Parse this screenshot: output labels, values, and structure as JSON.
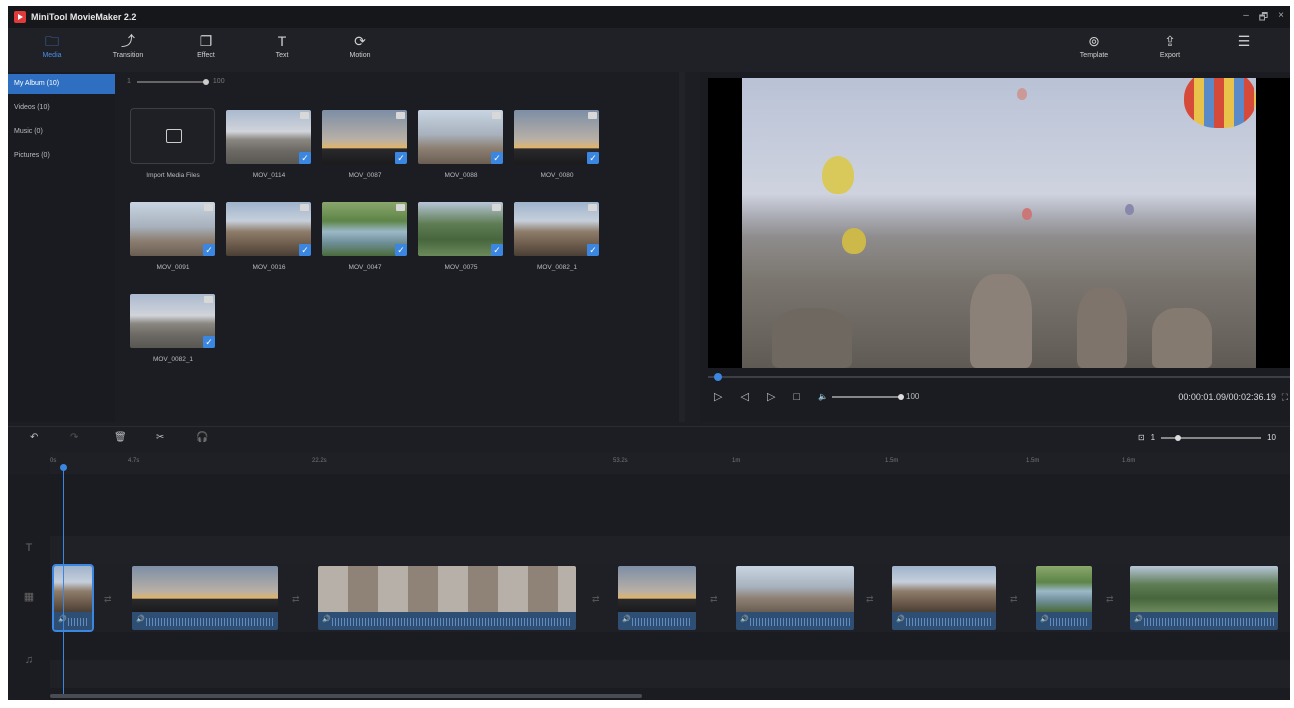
{
  "app": {
    "title": "MiniTool MovieMaker 2.2",
    "window_controls": [
      "–",
      "🗗",
      "×"
    ]
  },
  "toolbar": {
    "tabs": [
      {
        "label": "Media",
        "icon": "folder-icon",
        "glyph": "🗀"
      },
      {
        "label": "Transition",
        "icon": "transition-icon",
        "glyph": "⤴"
      },
      {
        "label": "Effect",
        "icon": "effect-icon",
        "glyph": "❐"
      },
      {
        "label": "Text",
        "icon": "text-icon",
        "glyph": "T"
      },
      {
        "label": "Motion",
        "icon": "motion-icon",
        "glyph": "⟳"
      }
    ],
    "right": [
      {
        "label": "Template",
        "icon": "template-icon",
        "glyph": "⊚"
      },
      {
        "label": "Export",
        "icon": "export-icon",
        "glyph": "⇪"
      },
      {
        "label": "",
        "icon": "menu-icon",
        "glyph": "☰"
      }
    ]
  },
  "library": {
    "categories": [
      "My Album (10)",
      "Videos (10)",
      "Music (0)",
      "Pictures (0)"
    ],
    "thumb_size": {
      "min": "1",
      "max": "100"
    },
    "import_label": "Import Media Files",
    "items": [
      "MOV_0114",
      "MOV_0087",
      "MOV_0088",
      "MOV_0080",
      "MOV_0091",
      "MOV_0016",
      "MOV_0047",
      "MOV_0075",
      "MOV_0082_1",
      "MOV_0082_1"
    ]
  },
  "preview": {
    "volume": "100",
    "timecode": "00:00:01.09/00:02:36.19",
    "progress": 0.01
  },
  "timeline": {
    "zoom_min": "1",
    "zoom_max": "10",
    "ruler": [
      "0s",
      "4.7s",
      "22.2s",
      "53.2s",
      "1m",
      "1.5m",
      "1.5m",
      "1.6m"
    ]
  }
}
